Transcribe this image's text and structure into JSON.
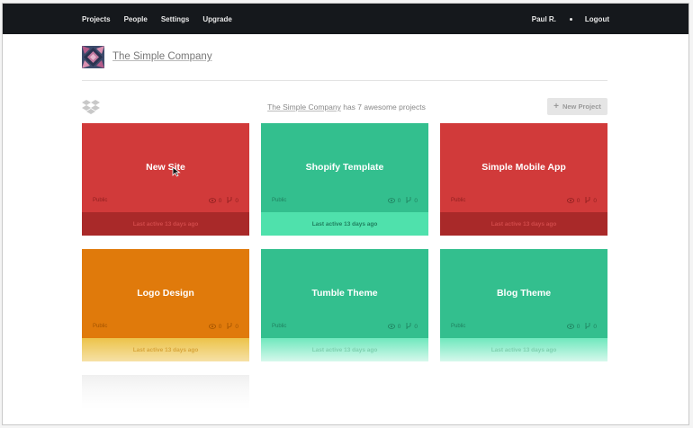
{
  "nav": {
    "items": [
      "Projects",
      "People",
      "Settings",
      "Upgrade"
    ],
    "user": "Paul R.",
    "logout": "Logout"
  },
  "company": {
    "name": "The Simple Company",
    "logo_icon": "company-logo"
  },
  "summary": {
    "company": "The Simple Company",
    "text": "has 7 awesome projects"
  },
  "new_project": {
    "label": "New Project",
    "icon": "plus-icon"
  },
  "colors": {
    "red": "#d13a3a",
    "green": "#33bf8e",
    "orange": "#e07a0b",
    "topbar": "#15181c"
  },
  "projects": [
    {
      "title": "New Site",
      "visibility": "Public",
      "views": "0",
      "forks": "0",
      "footer": "Last active 13 days ago",
      "color": "red"
    },
    {
      "title": "Shopify Template",
      "visibility": "Public",
      "views": "0",
      "forks": "0",
      "footer": "Last active 13 days ago",
      "color": "green"
    },
    {
      "title": "Simple Mobile App",
      "visibility": "Public",
      "views": "0",
      "forks": "0",
      "footer": "Last active 13 days ago",
      "color": "red"
    },
    {
      "title": "Logo Design",
      "visibility": "Public",
      "views": "0",
      "forks": "0",
      "footer": "Last active 13 days ago",
      "color": "orange"
    },
    {
      "title": "Tumble Theme",
      "visibility": "Public",
      "views": "0",
      "forks": "0",
      "footer": "Last active 13 days ago",
      "color": "green2"
    },
    {
      "title": "Blog Theme",
      "visibility": "Public",
      "views": "0",
      "forks": "0",
      "footer": "Last active 13 days ago",
      "color": "green2"
    }
  ]
}
